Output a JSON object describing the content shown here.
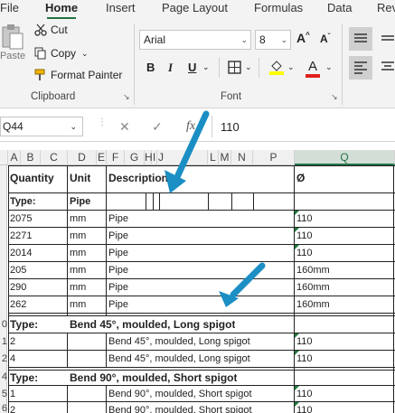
{
  "ribbon": {
    "tabs": [
      "File",
      "Home",
      "Insert",
      "Page Layout",
      "Formulas",
      "Data",
      "Rev"
    ],
    "active_tab": "Home",
    "clipboard": {
      "paste_label": "Paste",
      "cut_label": "Cut",
      "copy_label": "Copy",
      "format_painter_label": "Format Painter",
      "group_label": "Clipboard"
    },
    "font": {
      "font_name": "Arial",
      "font_size": "8",
      "grow_label": "A",
      "shrink_label": "A",
      "bold_label": "B",
      "italic_label": "I",
      "underline_label": "U",
      "font_color_label": "A",
      "group_label": "Font",
      "fill_color": "#ffff00",
      "font_color": "#e0201b"
    }
  },
  "formula_bar": {
    "name_box": "Q44",
    "fx_label": "fx",
    "value": "110"
  },
  "columns": [
    "A",
    "B",
    "C",
    "D",
    "E",
    "F",
    "G",
    "H",
    "I",
    "J",
    "L",
    "M",
    "N",
    "P",
    "Q"
  ],
  "selected_column": "Q",
  "rows": {
    "header": {
      "quantity": "Quantity",
      "unit": "Unit",
      "description": "Description",
      "diameter": "Ø"
    },
    "type_pipe": {
      "label": "Type:",
      "value": "Pipe"
    },
    "pipe_rows": [
      {
        "qty": "2075",
        "unit": "mm",
        "desc": "Pipe",
        "dia": "110"
      },
      {
        "qty": "2271",
        "unit": "mm",
        "desc": "Pipe",
        "dia": "110"
      },
      {
        "qty": "2014",
        "unit": "mm",
        "desc": "Pipe",
        "dia": "110"
      },
      {
        "qty": "205",
        "unit": "mm",
        "desc": "Pipe",
        "dia": "160mm"
      },
      {
        "qty": "290",
        "unit": "mm",
        "desc": "Pipe",
        "dia": "160mm"
      },
      {
        "qty": "262",
        "unit": "mm",
        "desc": "Pipe",
        "dia": "160mm"
      }
    ],
    "type_bend45": {
      "row": "0",
      "label": "Type:",
      "value": "Bend 45°, moulded, Long spigot"
    },
    "bend45_rows": [
      {
        "row": "1",
        "qty": "2",
        "desc": "Bend 45°, moulded, Long spigot",
        "dia": "110"
      },
      {
        "row": "2",
        "qty": "4",
        "desc": "Bend 45°, moulded, Long spigot",
        "dia": "110"
      }
    ],
    "type_bend90": {
      "row": "4",
      "label": "Type:",
      "value": "Bend 90°, moulded, Short spigot"
    },
    "bend90_rows": [
      {
        "row": "5",
        "qty": "1",
        "desc": "Bend 90°, moulded, Short spigot",
        "dia": "110"
      },
      {
        "row": "6",
        "qty": "2",
        "desc": "Bend 90°, moulded, Short spigot",
        "dia": "110"
      }
    ]
  },
  "colors": {
    "accent": "#217346",
    "arrow": "#1b8fc4",
    "error_triangle": "#1f7a3d"
  },
  "icons": [
    "paste-icon",
    "scissors-icon",
    "copy-icon",
    "format-painter-icon",
    "borders-icon",
    "fill-color-icon",
    "align-top-icon",
    "align-left-icon"
  ]
}
